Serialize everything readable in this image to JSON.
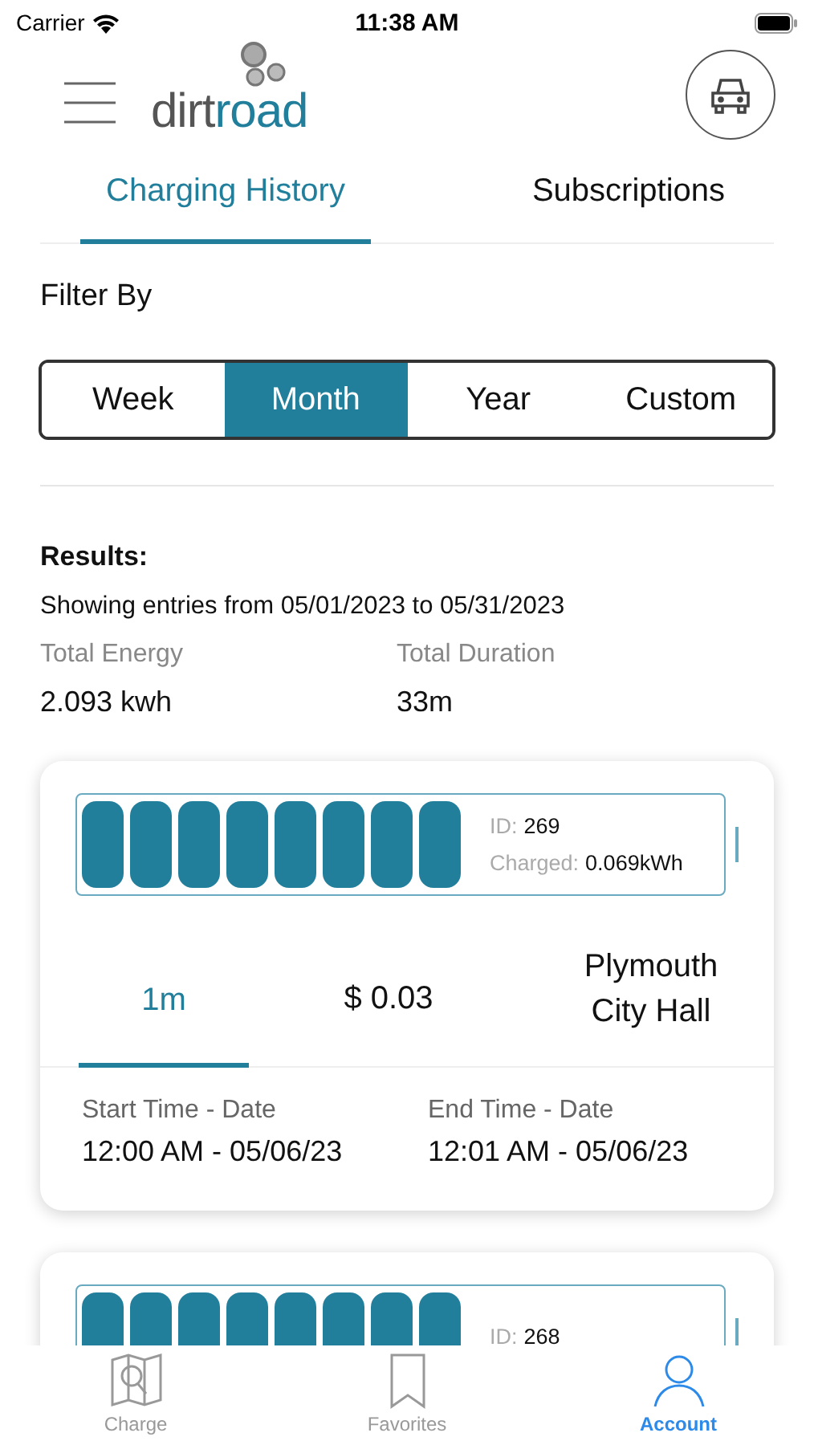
{
  "status_bar": {
    "carrier": "Carrier",
    "time": "11:38 AM"
  },
  "header": {
    "logo_dark": "dirt",
    "logo_accent": "road"
  },
  "tabs": [
    {
      "label": "Charging History",
      "selected": true
    },
    {
      "label": "Subscriptions",
      "selected": false
    }
  ],
  "filter": {
    "label": "Filter By",
    "options": [
      {
        "label": "Week",
        "selected": false
      },
      {
        "label": "Month",
        "selected": true
      },
      {
        "label": "Year",
        "selected": false
      },
      {
        "label": "Custom",
        "selected": false
      }
    ]
  },
  "results": {
    "title": "Results:",
    "range": "Showing entries from 05/01/2023 to 05/31/2023",
    "stats": [
      {
        "label": "Total Energy",
        "value": "2.093 kwh"
      },
      {
        "label": "Total Duration",
        "value": "33m"
      }
    ]
  },
  "sessions": [
    {
      "id_label": "ID:",
      "id": "269",
      "charged_label": "Charged:",
      "charged": "0.069kWh",
      "duration": "1m",
      "price": "$ 0.03",
      "location": "Plymouth City Hall",
      "start_label": "Start Time - Date",
      "start": "12:00 AM - 05/06/23",
      "end_label": "End Time - Date",
      "end": "12:01 AM - 05/06/23"
    },
    {
      "id_label": "ID:",
      "id": "268"
    }
  ],
  "bottom_nav": [
    {
      "label": "Charge",
      "kind": "map",
      "selected": false
    },
    {
      "label": "Favorites",
      "kind": "bookmark",
      "selected": false
    },
    {
      "label": "Account",
      "kind": "person",
      "selected": true
    }
  ]
}
